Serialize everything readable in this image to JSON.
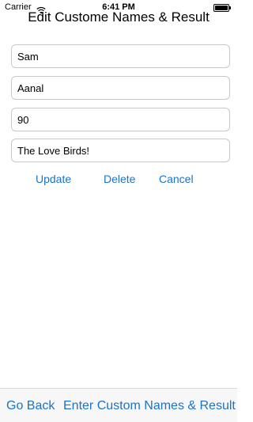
{
  "status_bar": {
    "carrier": "Carrier",
    "time": "6:41 PM",
    "battery_level": 1.0,
    "icons": [
      "wifi-icon",
      "battery-icon"
    ]
  },
  "title": "Edit Custome Names & Result",
  "fields": {
    "name1": "Sam",
    "name2": "Aanal",
    "result": "90",
    "message": "The Love Birds!"
  },
  "actions": {
    "update": "Update",
    "delete": "Delete",
    "cancel": "Cancel"
  },
  "toolbar": {
    "go_back": "Go Back",
    "enter_custom": "Enter Custom Names & Result"
  },
  "colors": {
    "accent": "#1a73c8",
    "toolbar_bg": "#f7f7f7",
    "field_border": "#c8c7cc"
  }
}
